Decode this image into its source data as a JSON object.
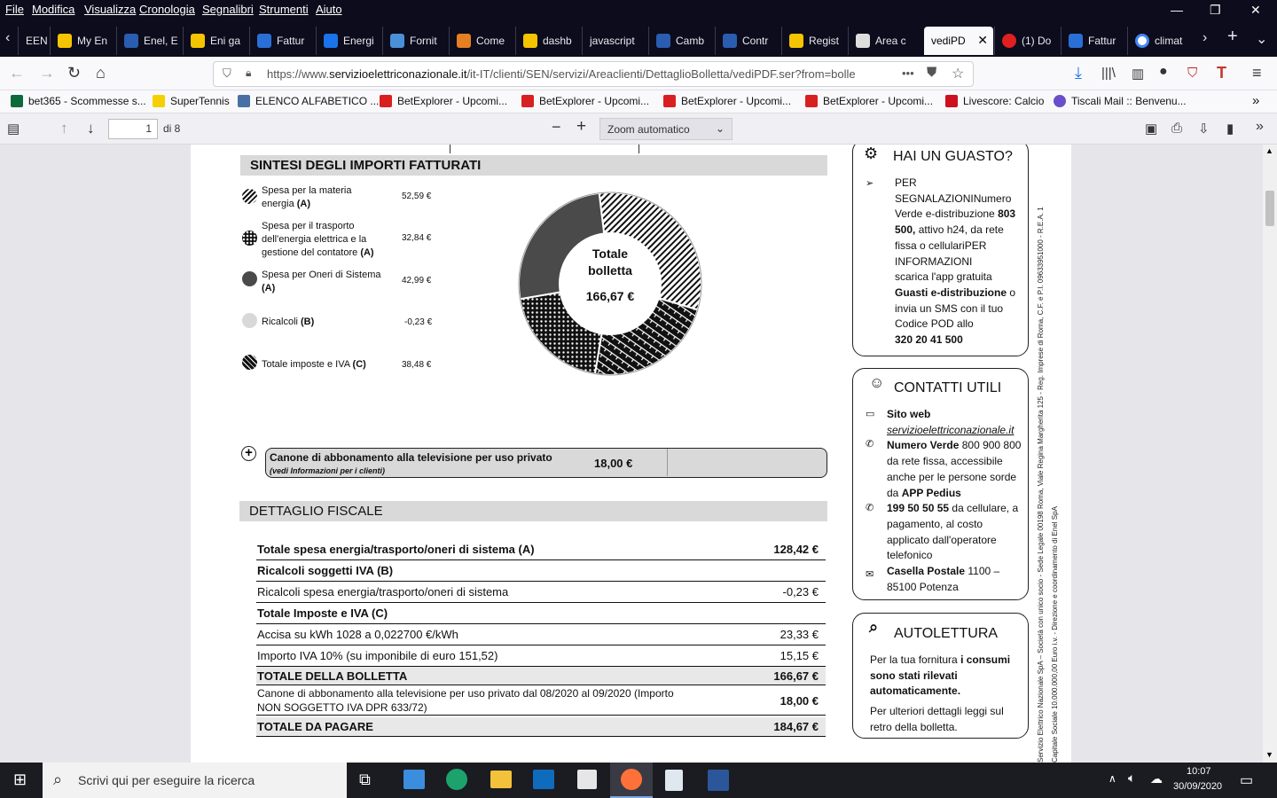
{
  "menubar": {
    "items": [
      "File",
      "Modifica",
      "Visualizza",
      "Cronologia",
      "Segnalibri",
      "Strumenti",
      "Aiuto"
    ]
  },
  "tabs": [
    "EEN",
    "My En",
    "Enel, E",
    "Eni ga",
    "Fattur",
    "Energi",
    "Fornit",
    "Come",
    "dashb",
    "javascript",
    "Camb",
    "Contr",
    "Regist",
    "Area c",
    "vediPD",
    "(1) Do",
    "Fattur",
    "climat"
  ],
  "url": {
    "prefix": "https://www.",
    "domain": "servizioelettriconazionale.it",
    "rest": "/it-IT/clienti/SEN/servizi/Areaclienti/DettaglioBolletta/vediPDF.ser?from=bolle",
    "more": "•••"
  },
  "bookmarks": [
    "bet365 - Scommesse s...",
    "SuperTennis",
    "ELENCO ALFABETICO ...",
    "BetExplorer - Upcomi...",
    "BetExplorer - Upcomi...",
    "BetExplorer - Upcomi...",
    "BetExplorer - Upcomi...",
    "Livescore: Calcio",
    "Tiscali Mail :: Benvenu..."
  ],
  "pdf": {
    "page": "1",
    "of": "di 8",
    "zoom": "Zoom automatico"
  },
  "sintesi": {
    "title": "SINTESI DEGLI IMPORTI FATTURATI",
    "items": [
      {
        "l1": "Spesa per la materia",
        "l2": "energia ",
        "b": "(A)",
        "value": "52,59 €"
      },
      {
        "l1": "Spesa per il trasporto",
        "l2": "dell'energia elettrica e la",
        "l3": "gestione del contatore ",
        "b": "(A)",
        "value": "32,84 €"
      },
      {
        "l1": "Spesa per Oneri di Sistema",
        "l2": "",
        "b": "(A)",
        "value": "42,99 €"
      },
      {
        "l1": "Ricalcoli ",
        "b": "(B)",
        "value": "-0,23 €"
      },
      {
        "l1": "Totale imposte e IVA ",
        "b": "(C)",
        "value": "38,48 €"
      }
    ],
    "donut_center": {
      "line1": "Totale",
      "line2": "bolletta",
      "amount": "166,67 €"
    }
  },
  "chart_data": {
    "type": "pie",
    "categories": [
      "Spesa per la materia energia (A)",
      "Spesa per il trasporto dell'energia elettrica e la gestione del contatore (A)",
      "Spesa per Oneri di Sistema (A)",
      "Ricalcoli (B)",
      "Totale imposte e IVA (C)"
    ],
    "values": [
      52.59,
      32.84,
      42.99,
      -0.23,
      38.48
    ],
    "total": "166,67 €"
  },
  "canone": {
    "label": "Canone di abbonamento alla televisione per uso privato",
    "note": "(vedi Informazioni per i clienti)",
    "value": "18,00 €"
  },
  "dettaglio": {
    "title": "DETTAGLIO FISCALE",
    "rows": [
      {
        "l": "Totale spesa energia/trasporto/oneri di sistema (A)",
        "r": "128,42 €"
      },
      {
        "l": "Ricalcoli soggetti IVA (B)",
        "r": ""
      },
      {
        "l": "Ricalcoli spesa energia/trasporto/oneri di sistema",
        "r": "-0,23 €"
      },
      {
        "l": "Totale Imposte e IVA (C)",
        "r": ""
      },
      {
        "l": "Accisa su kWh 1028 a 0,022700 €/kWh",
        "r": "23,33 €"
      },
      {
        "l": "Importo IVA 10% (su imponibile di euro 151,52)",
        "r": "15,15 €"
      },
      {
        "l": "TOTALE DELLA BOLLETTA",
        "r": "166,67 €"
      },
      {
        "l": "Canone di abbonamento alla televisione per uso privato dal 08/2020 al 09/2020 (Importo",
        "l2": "NON SOGGETTO IVA DPR 633/72)",
        "r": "18,00 €"
      },
      {
        "l": "TOTALE DA PAGARE",
        "r": "184,67 €"
      }
    ]
  },
  "guasto": {
    "title": "HAI UN GUASTO?",
    "lines": [
      "PER",
      "SEGNALAZIONINumero",
      "Verde e-distribuzione ",
      "500,",
      " attivo h24, da rete",
      "fissa o cellulariPER",
      "INFORMAZIONI",
      " scarica l'app gratuita",
      "Guasti e-distribuzione",
      " o",
      "invia un SMS con il tuo",
      "Codice POD allo",
      " 320 20 41 500",
      "803"
    ]
  },
  "contatti": {
    "title": "CONTATTI UTILI",
    "sito": "Sito web",
    "url": "servizioelettriconazionale.it",
    "nv": "Numero Verde",
    " nvnum": "800 900 800",
    "l1": "da rete fissa, accessibile",
    "l2": "anche per le persone sorde",
    "l3a": "da ",
    "app": "APP Pedius",
    "num2": "199 50 50 55",
    "l4": " da cellulare, a",
    "l5": "pagamento, al costo",
    "l6": "applicato dall'operatore",
    "l7": "telefonico",
    "cp": "Casella Postale",
    "cpv": " 1100 –",
    "cp2": "85100 Potenza",
    "nvnum": "800 900 800"
  },
  "autolettura": {
    "title": "AUTOLETTURA",
    "a1": "Per la tua fornitura ",
    "a1b": "i consumi",
    "a2": "sono stati rilevati",
    "a3": "automaticamente.",
    "b1": "Per ulteriori dettagli leggi sul",
    "b2": "retro della bolletta."
  },
  "vertical1": "Servizio Elettrico Nazionale SpA – Società con unico socio - Sede Legale 00198 Roma, Viale Regina Margherita 125 - Reg. Imprese di Roma, C.F. e P.I. 09633951000 - R.E.A. 1",
  "vertical2": "Capitale Sociale 10.000.000,00 Euro i.v. - Direzione e coordinamento di Enel SpA",
  "taskbar": {
    "search": "Scrivi qui per eseguire la ricerca",
    "time": "10:07",
    "date": "30/09/2020"
  }
}
